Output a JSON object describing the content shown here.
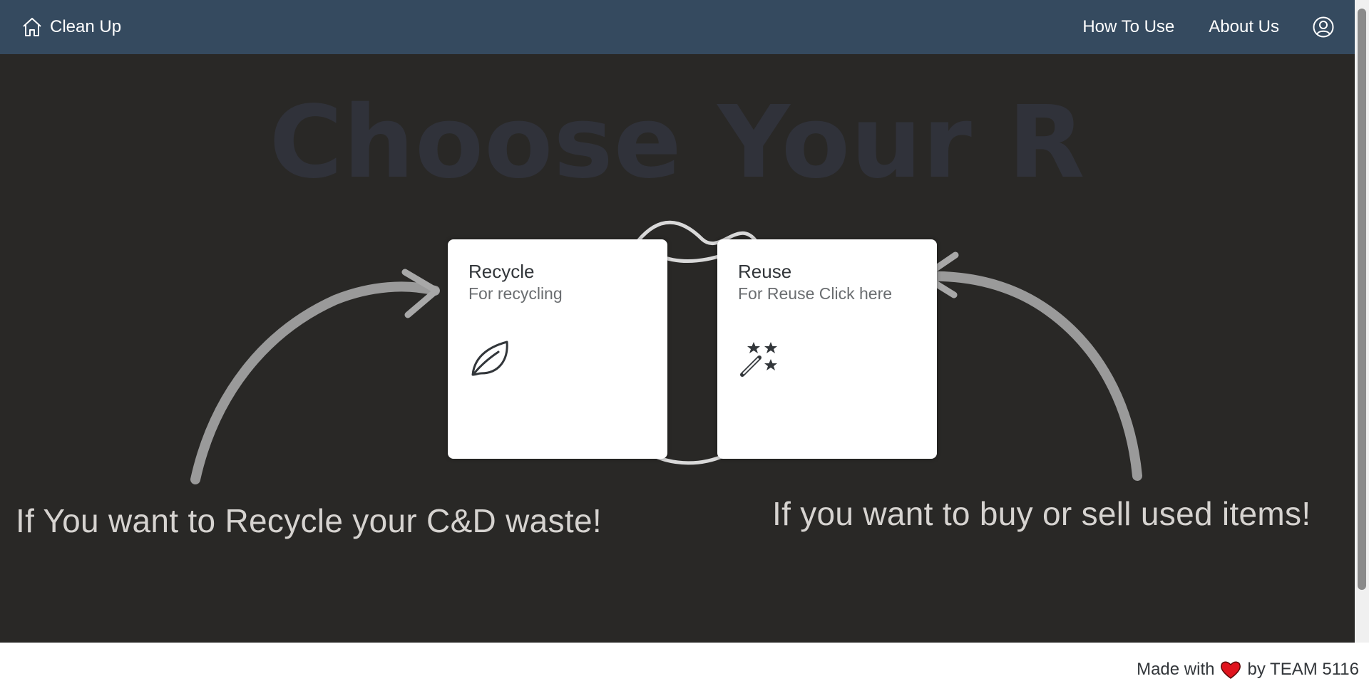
{
  "header": {
    "brand": "Clean Up",
    "brand_icon": "home-icon",
    "nav": [
      "How To Use",
      "About Us"
    ],
    "user_icon": "user-account-icon"
  },
  "hero": {
    "title": "Choose Your R",
    "cards": [
      {
        "title": "Recycle",
        "subtitle": "For recycling",
        "icon": "leaf-icon"
      },
      {
        "title": "Reuse",
        "subtitle": "For Reuse Click here",
        "icon": "magic-wand-icon"
      }
    ],
    "captions": {
      "left": "If You want to Recycle your C&D waste!",
      "right": "If you want to buy or sell used items!"
    }
  },
  "footer": {
    "prefix": "Made with",
    "suffix": "by TEAM 5116",
    "icon": "heart-icon"
  },
  "colors": {
    "header_bg": "#354a5f",
    "hero_bg": "#292826",
    "title_color": "#30323a",
    "heart": "#e0141e"
  }
}
